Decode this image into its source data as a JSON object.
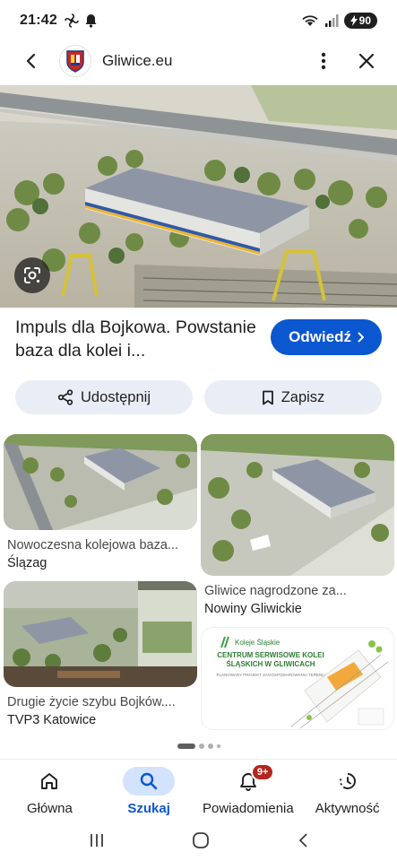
{
  "status_bar": {
    "time": "21:42",
    "battery": "90"
  },
  "top_bar": {
    "site_name": "Gliwice.eu"
  },
  "result": {
    "title": "Impuls dla Bojkowa. Powstanie baza dla kolei i...",
    "visit_label": "Odwiedź"
  },
  "actions": {
    "share_label": "Udostępnij",
    "save_label": "Zapisz"
  },
  "related": [
    {
      "caption": "Nowoczesna kolejowa baza...",
      "source": "Ślązag"
    },
    {
      "caption": "Drugie życie szybu Bojków....",
      "source": "TVP3 Katowice"
    },
    {
      "caption": "Gliwice nagrodzone za...",
      "source": "Nowiny Gliwickie"
    },
    {
      "brand": "Koleje Śląskie",
      "poster_title": "CENTRUM SERWISOWE KOLEI ŚLĄSKICH W GLIWICACH",
      "poster_subtitle": "PLANOWANY PROJEKT ZAGOSPODAROWANIA TERENU"
    }
  ],
  "bottom_nav": {
    "items": [
      {
        "label": "Główna",
        "icon": "home-icon"
      },
      {
        "label": "Szukaj",
        "icon": "search-icon"
      },
      {
        "label": "Powiadomienia",
        "icon": "bell-icon",
        "badge": "9+"
      },
      {
        "label": "Aktywność",
        "icon": "activity-icon"
      }
    ],
    "active_index": 1
  },
  "colors": {
    "accent": "#0b57d0",
    "chip_bg": "#e9eef6",
    "active_pill": "#d3e3fd",
    "badge": "#b3261e"
  }
}
